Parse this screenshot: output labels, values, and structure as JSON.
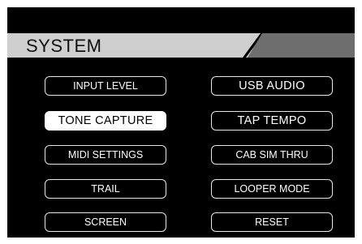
{
  "header": {
    "title": "SYSTEM"
  },
  "menu": {
    "left": [
      {
        "label": "INPUT LEVEL"
      },
      {
        "label": "TONE CAPTURE"
      },
      {
        "label": "MIDI SETTINGS"
      },
      {
        "label": "TRAIL"
      },
      {
        "label": "SCREEN"
      }
    ],
    "right": [
      {
        "label": "USB AUDIO"
      },
      {
        "label": "TAP TEMPO"
      },
      {
        "label": "CAB SIM THRU"
      },
      {
        "label": "LOOPER MODE"
      },
      {
        "label": "RESET"
      }
    ],
    "selected": "TONE CAPTURE"
  },
  "colors": {
    "background": "#000000",
    "header_bar": "#cfcfcf",
    "header_accent": "#6e6e6e",
    "button_border": "#e6e6e6",
    "selected_bg": "#ffffff"
  }
}
